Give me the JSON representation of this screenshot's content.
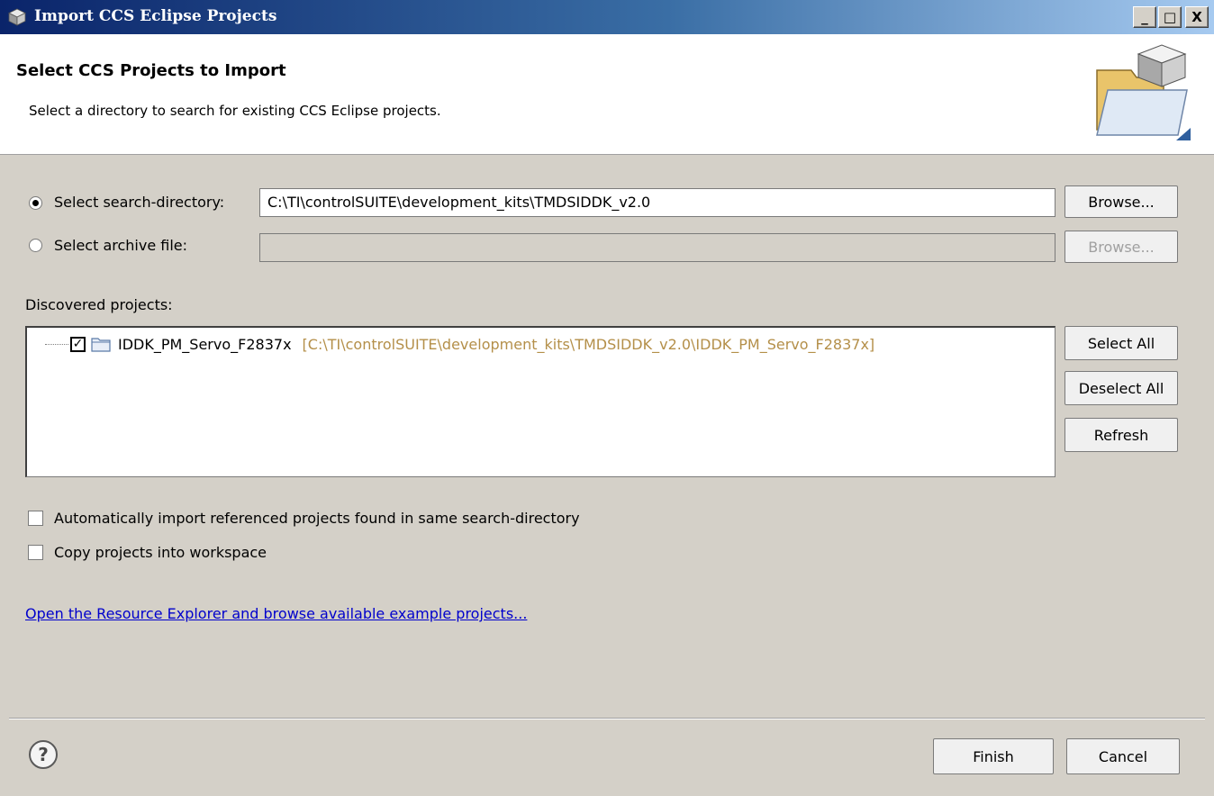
{
  "window": {
    "title": "Import CCS Eclipse Projects",
    "controls": {
      "minimize": "_",
      "maximize": "□",
      "close": "X"
    }
  },
  "header": {
    "title": "Select CCS Projects to Import",
    "description": "Select a directory to search for existing CCS Eclipse projects."
  },
  "source": {
    "directory_label": "Select search-directory:",
    "directory_value": "C:\\TI\\controlSUITE\\development_kits\\TMDSIDDK_v2.0",
    "directory_selected": true,
    "archive_label": "Select archive file:",
    "archive_value": "",
    "browse_label": "Browse...",
    "browse_disabled_label": "Browse..."
  },
  "projects": {
    "label": "Discovered projects:",
    "items": [
      {
        "name": "IDDK_PM_Servo_F2837x",
        "path": "[C:\\TI\\controlSUITE\\development_kits\\TMDSIDDK_v2.0\\IDDK_PM_Servo_F2837x]",
        "checked": true
      }
    ],
    "select_all": "Select All",
    "deselect_all": "Deselect All",
    "refresh": "Refresh"
  },
  "options": {
    "auto_import_label": "Automatically import referenced projects found in same search-directory",
    "copy_label": "Copy projects into workspace"
  },
  "link": "Open the Resource Explorer and browse available example projects...",
  "footer": {
    "help": "?",
    "finish": "Finish",
    "cancel": "Cancel"
  },
  "colors": {
    "dialog_bg": "#d4d0c8",
    "path_text": "#b48f49",
    "link": "#0000cc"
  }
}
